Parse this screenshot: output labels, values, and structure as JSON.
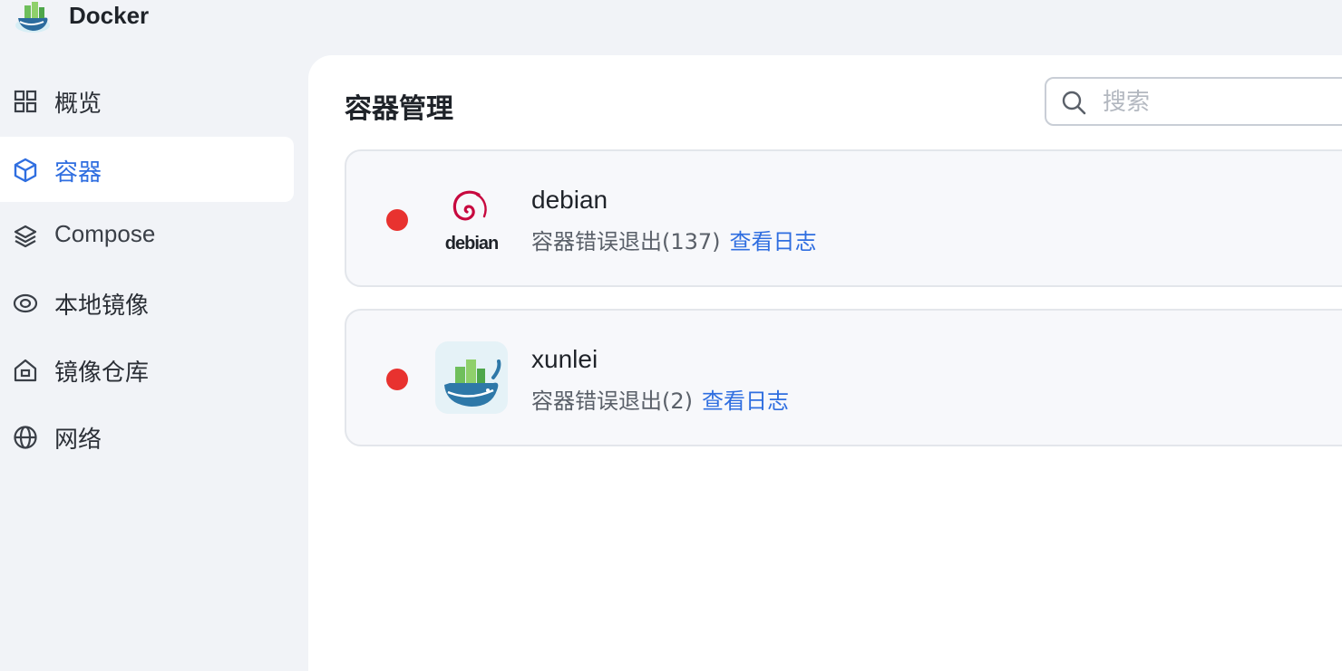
{
  "app": {
    "title": "Docker",
    "logo": "docker-whale-logo"
  },
  "sidebar": {
    "items": [
      {
        "label": "概览",
        "icon": "grid-icon",
        "active": false
      },
      {
        "label": "容器",
        "icon": "cube-icon",
        "active": true
      },
      {
        "label": "Compose",
        "icon": "layers-icon",
        "active": false
      },
      {
        "label": "本地镜像",
        "icon": "disc-icon",
        "active": false
      },
      {
        "label": "镜像仓库",
        "icon": "house-icon",
        "active": false
      },
      {
        "label": "网络",
        "icon": "globe-icon",
        "active": false
      }
    ]
  },
  "main": {
    "title": "容器管理",
    "search": {
      "placeholder": "搜索",
      "value": ""
    },
    "containers": [
      {
        "name": "debian",
        "status": "容器错误退出(137)",
        "link": "查看日志",
        "logo": "debian-logo",
        "status_color": "#e8322f"
      },
      {
        "name": "xunlei",
        "status": "容器错误退出(2)",
        "link": "查看日志",
        "logo": "xunlei-whale-logo",
        "status_color": "#e8322f"
      }
    ]
  },
  "colors": {
    "accent": "#2f6ee0",
    "error": "#e8322f",
    "background": "#f1f3f7"
  }
}
